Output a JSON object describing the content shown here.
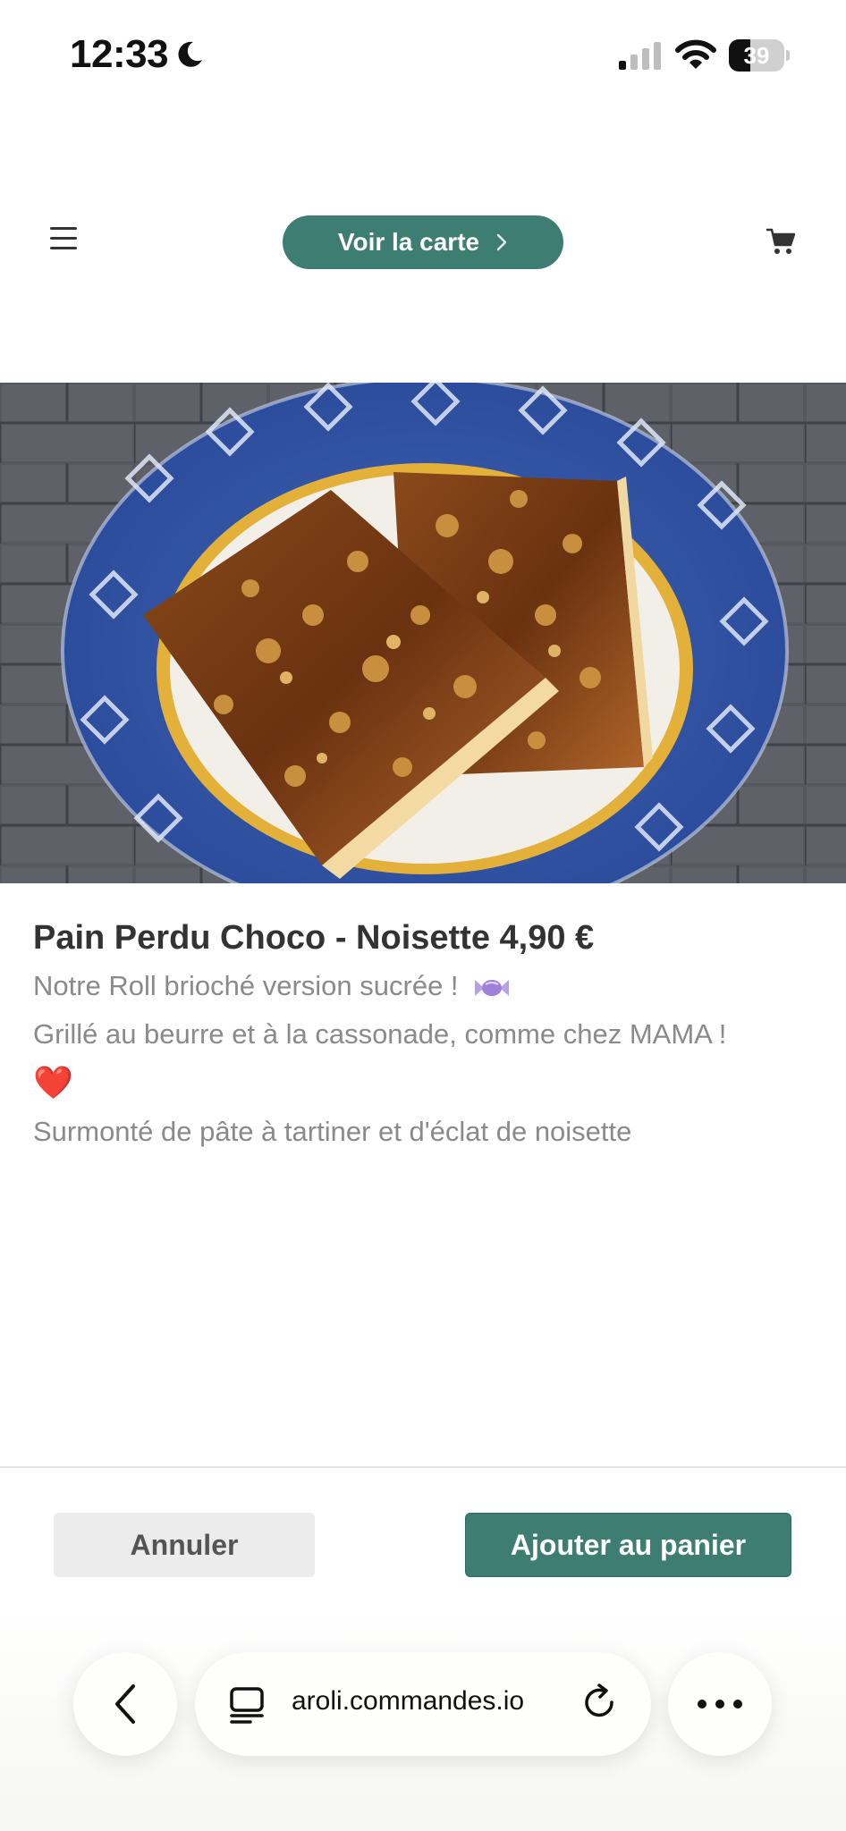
{
  "status_bar": {
    "time": "12:33",
    "battery_level": "39",
    "battery_fraction": 0.39,
    "icons": [
      "moon-icon",
      "signal-icon",
      "wifi-icon",
      "battery-icon"
    ]
  },
  "nav": {
    "menu_icon": "hamburger-menu-icon",
    "voir_label": "Voir la carte",
    "cart_icon": "shopping-cart-icon"
  },
  "product": {
    "image_icon": "french-toast-plate-photo",
    "title": "Pain Perdu Choco - Noisette 4,90 €",
    "desc_1": "Notre Roll brioché version sucrée !",
    "desc_2": "Grillé au beurre et à la cassonade, comme chez MAMA !",
    "heart": "❤️",
    "desc_3": "Surmonté de pâte à tartiner et d'éclat de noisette"
  },
  "actions": {
    "cancel_label": "Annuler",
    "add_label": "Ajouter au panier"
  },
  "browser": {
    "url": "aroli.commandes.io",
    "icons": [
      "back-icon",
      "tabs-icon",
      "reload-icon",
      "more-icon"
    ]
  },
  "colors": {
    "accent": "#3e7d72",
    "text_dark": "#333333",
    "text_muted": "#8a8a8a",
    "cancel_bg": "#ececec"
  }
}
